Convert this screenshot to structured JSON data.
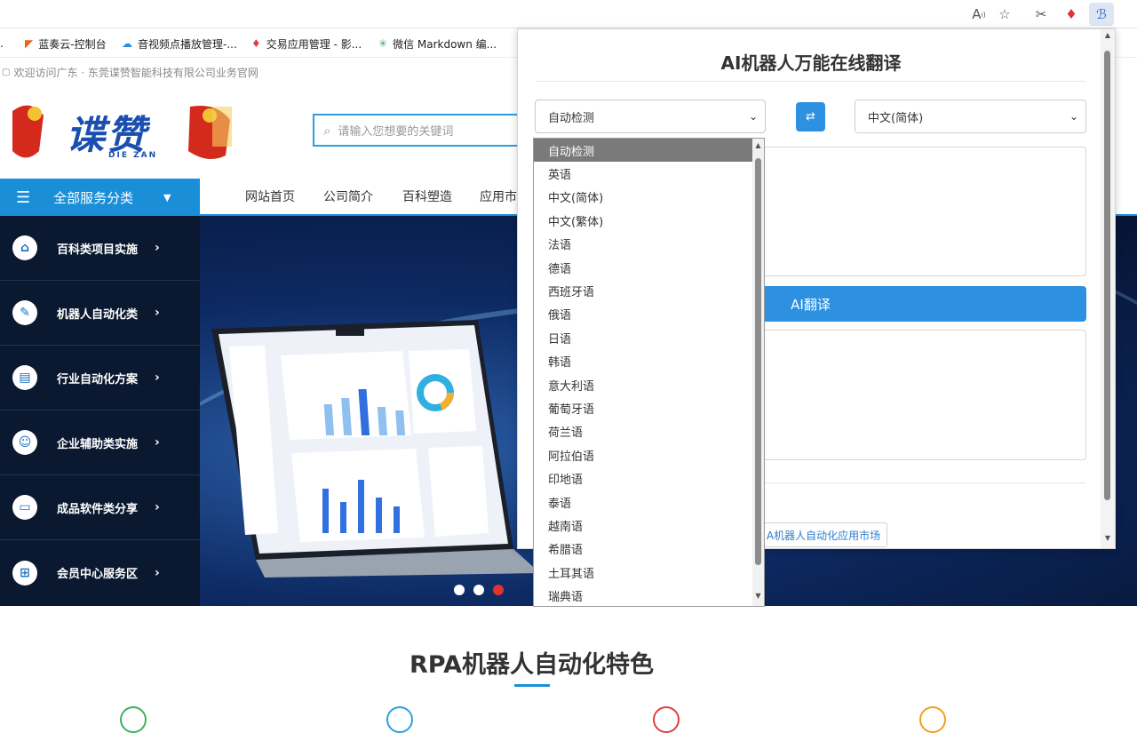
{
  "browser": {
    "bookmarks": [
      {
        "label": "蓝奏云-控制台",
        "icon": "lanzou-icon"
      },
      {
        "label": "音视频点播放管理-...",
        "icon": "cloud-icon"
      },
      {
        "label": "交易应用管理 - 影...",
        "icon": "gem-icon"
      },
      {
        "label": "微信 Markdown 编...",
        "icon": "sparkle-icon"
      }
    ]
  },
  "site": {
    "welcome": "欢迎访问广东 · 东莞谍赞智能科技有限公司业务官网",
    "logo_text": "谍赞",
    "logo_sub": "DIE ZAN",
    "search_placeholder": "请输入您想要的关键词",
    "category_button": "全部服务分类",
    "nav": [
      "网站首页",
      "公司简介",
      "百科塑造",
      "应用市"
    ],
    "sidebar": [
      "百科类项目实施",
      "机器人自动化类",
      "行业自动化方案",
      "企业辅助类实施",
      "成品软件类分享",
      "会员中心服务区"
    ],
    "features_title": "RPA机器人自动化特色"
  },
  "translator": {
    "title": "AI机器人万能在线翻译",
    "source_lang": "自动检测",
    "target_lang": "中文(简体)",
    "translate_button": "AI翻译",
    "market_link": "A机器人自动化应用市场",
    "options": [
      "自动检测",
      "英语",
      "中文(简体)",
      "中文(繁体)",
      "法语",
      "德语",
      "西班牙语",
      "俄语",
      "日语",
      "韩语",
      "意大利语",
      "葡萄牙语",
      "荷兰语",
      "阿拉伯语",
      "印地语",
      "泰语",
      "越南语",
      "希腊语",
      "土耳其语",
      "瑞典语"
    ],
    "selected_option": "自动检测",
    "accent_color": "#2d90e0"
  }
}
